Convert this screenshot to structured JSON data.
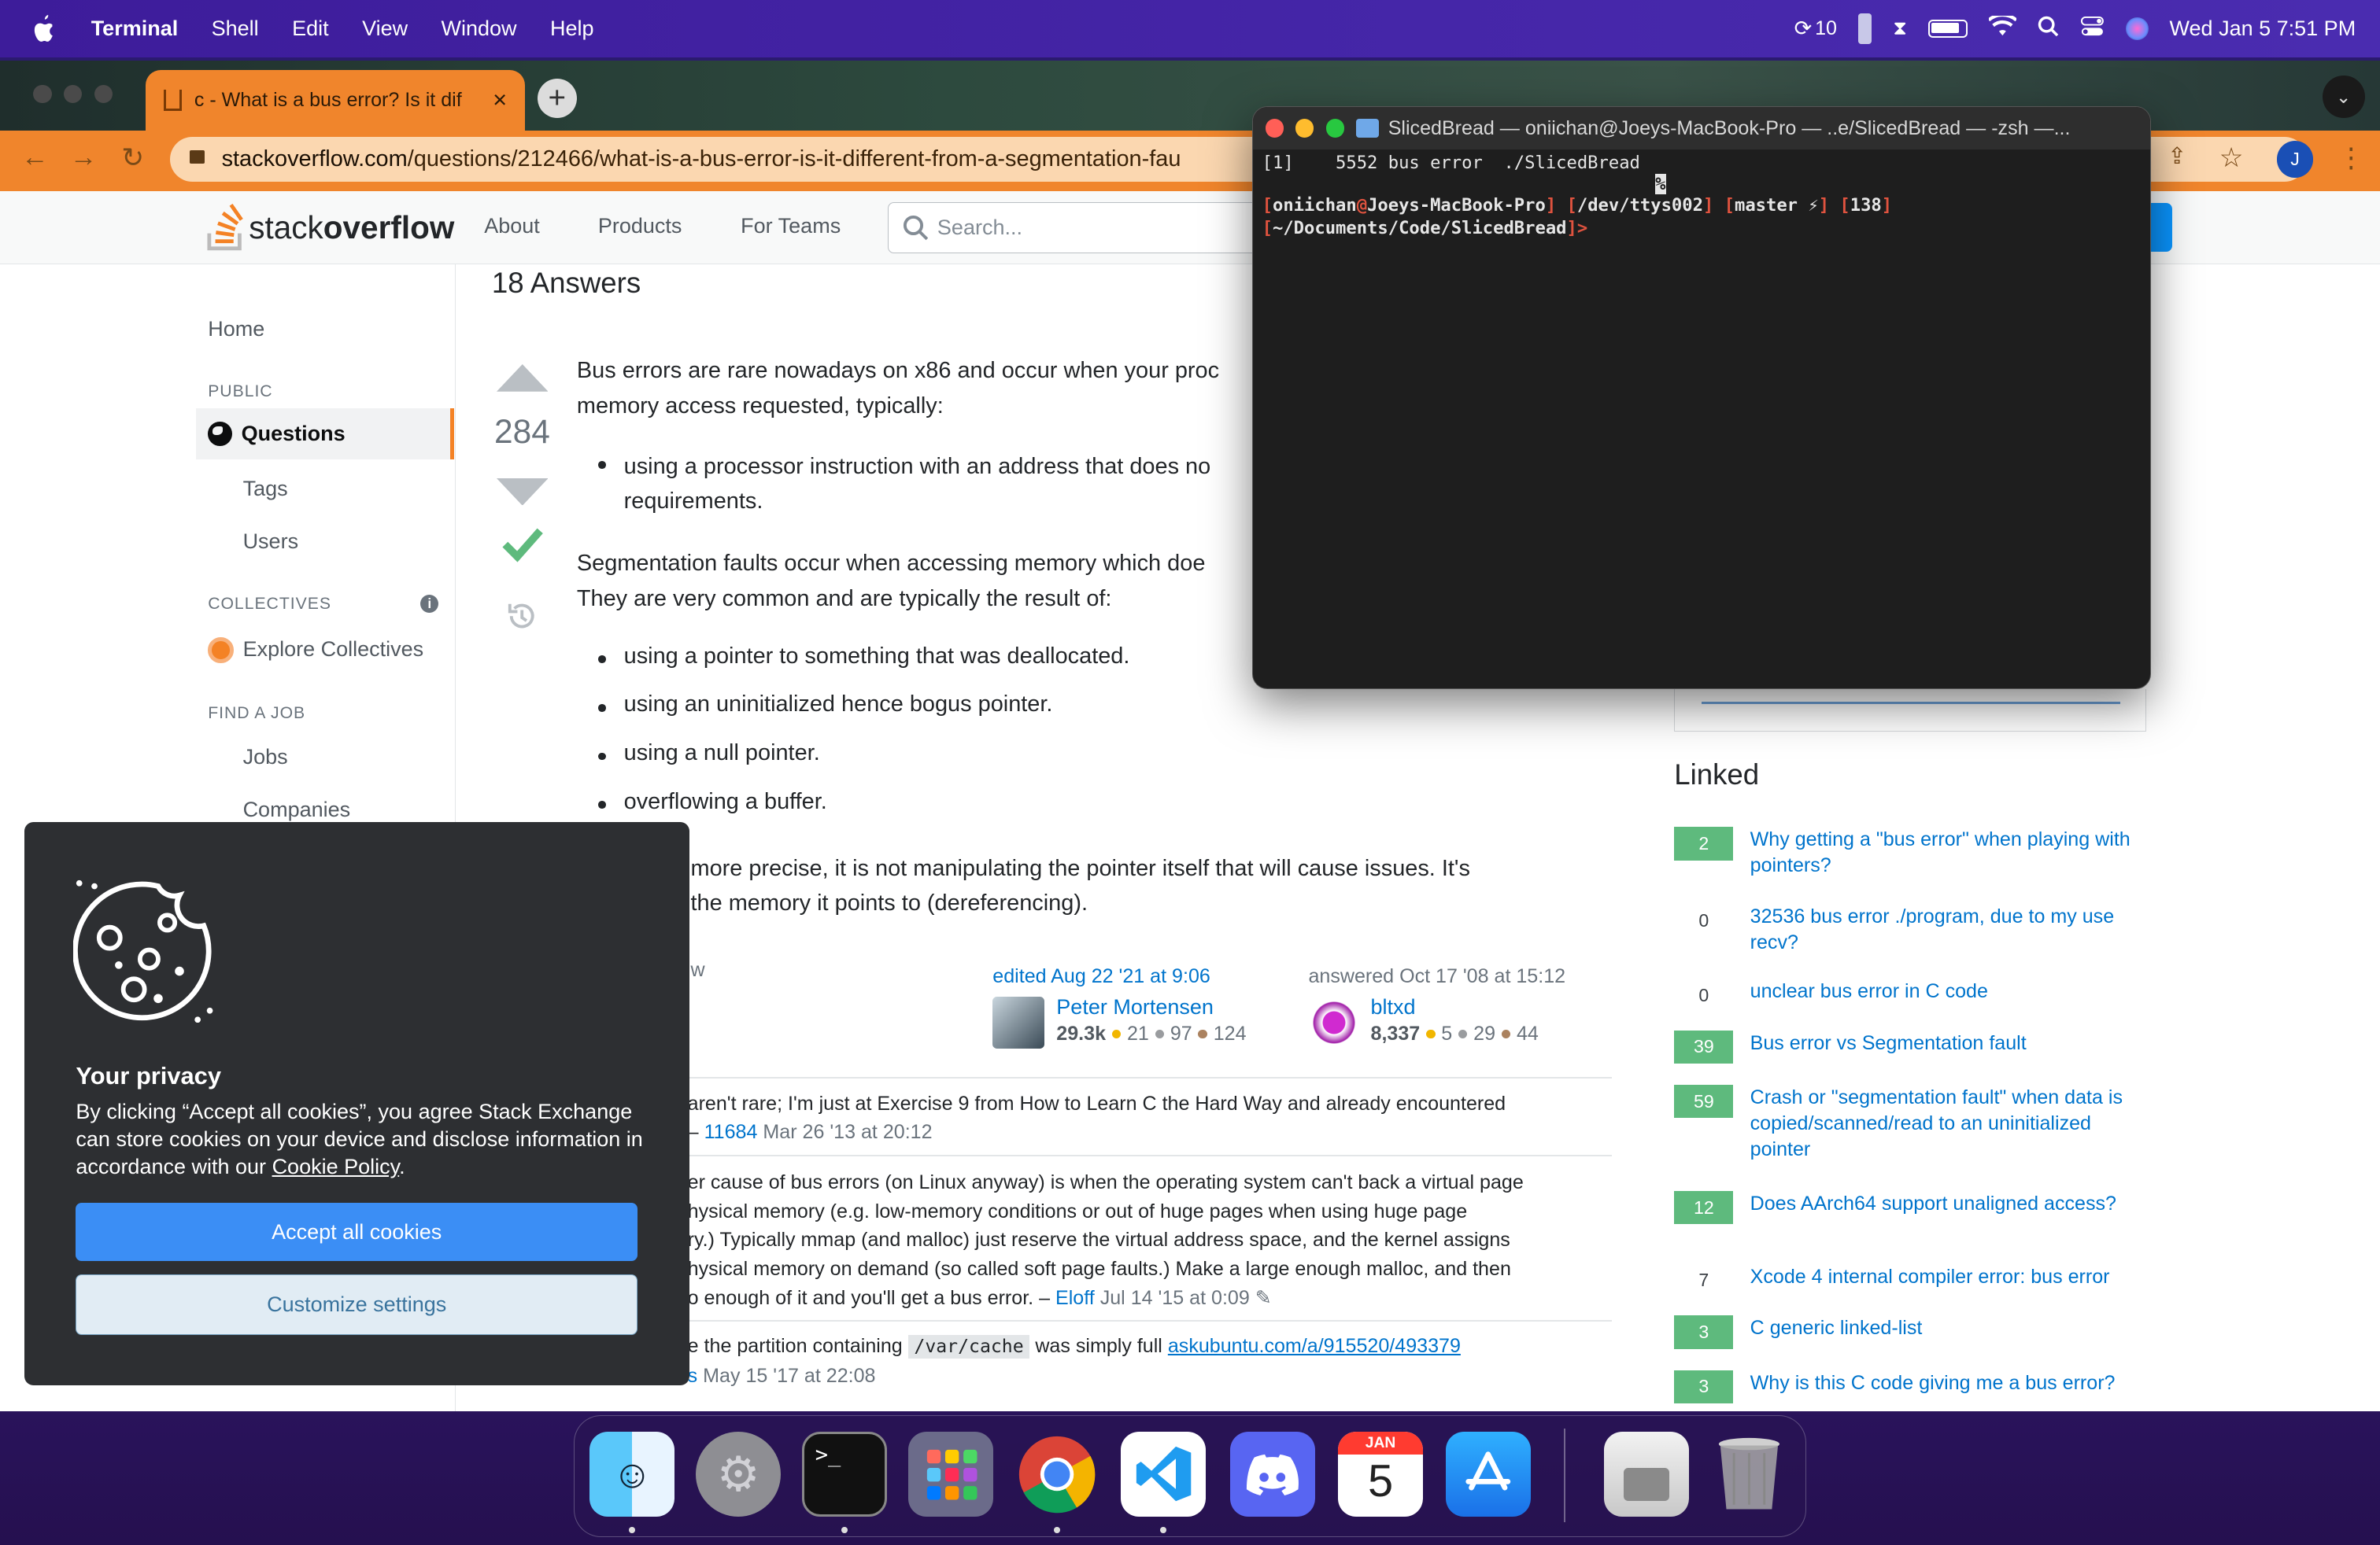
{
  "menubar": {
    "app": "Terminal",
    "items": [
      "Shell",
      "Edit",
      "View",
      "Window",
      "Help"
    ],
    "status": {
      "updates": "10",
      "datetime": "Wed Jan 5  7:51 PM"
    }
  },
  "browser": {
    "tab_title": "c - What is a bus error? Is it dif",
    "url_host": "stackoverflow.com",
    "url_path": "/questions/212466/what-is-a-bus-error-is-it-different-from-a-segmentation-fau",
    "profile_initial": "J"
  },
  "so_header": {
    "logo_a": "stack",
    "logo_b": "overflow",
    "nav": [
      "About",
      "Products",
      "For Teams"
    ],
    "search_placeholder": "Search..."
  },
  "sidebar": {
    "home": "Home",
    "public_heading": "PUBLIC",
    "questions": "Questions",
    "tags": "Tags",
    "users": "Users",
    "collectives_heading": "COLLECTIVES",
    "explore_collectives": "Explore Collectives",
    "find_job_heading": "FIND A JOB",
    "jobs": "Jobs",
    "companies": "Companies"
  },
  "answer": {
    "answers_count": "18 Answers",
    "score": "284",
    "p1a": "Bus errors are rare nowadays on x86 and occur when your proc",
    "p1b": "memory access requested, typically:",
    "b1a": "using a processor instruction with an address that does no",
    "b1b": "requirements.",
    "p2a": "Segmentation faults occur when accessing memory which doe",
    "p2b": "They are very common and are typically the result of:",
    "bullets": [
      "using a pointer to something that was deallocated.",
      "using an uninitialized hence bogus pointer.",
      "using a null pointer.",
      "overflowing a buffer."
    ],
    "p3a": "more precise, it is not manipulating the pointer itself that will cause issues. It's",
    "p3b": "the memory it points to (dereferencing).",
    "follow_fragment": "w",
    "edited": "edited Aug 22 '21 at 9:06",
    "editor": "Peter Mortensen",
    "editor_rep": "29.3k",
    "editor_badges": [
      "21",
      "97",
      "124"
    ],
    "answered": "answered Oct 17 '08 at 15:12",
    "author": "bltxd",
    "author_rep": "8,337",
    "author_badges": [
      "5",
      "29",
      "44"
    ]
  },
  "comments": [
    {
      "text": "aren't rare; I'm just at Exercise 9 from How to Learn C the Hard Way and already encountered",
      "sep": "–",
      "user": "11684",
      "date": "Mar 26 '13 at 20:12"
    },
    {
      "lines": [
        "er cause of bus errors (on Linux anyway) is when the operating system can't back a virtual page",
        "hysical memory (e.g. low-memory conditions or out of huge pages when using huge page",
        "ry.) Typically mmap (and malloc) just reserve the virtual address space, and the kernel assigns",
        "hysical memory on demand (so called soft page faults.) Make a large enough malloc, and then",
        "o enough of it and you'll get a bus error. –"
      ],
      "user": "Eloff",
      "date": "Jul 14 '15 at 0:09"
    },
    {
      "pre": "e the partition containing",
      "code": "/var/cache",
      "mid": "was simply full",
      "link": "askubuntu.com/a/915520/493379",
      "user": "s",
      "date": "May 15 '17 at 22:08"
    }
  ],
  "linked": {
    "heading": "Linked",
    "items": [
      {
        "count": "2",
        "accepted": true,
        "title": "Why getting a \"bus error\" when playing with pointers?"
      },
      {
        "count": "0",
        "accepted": false,
        "title": "32536 bus error ./program, due to my use recv?"
      },
      {
        "count": "0",
        "accepted": false,
        "title": "unclear bus error in C code"
      },
      {
        "count": "39",
        "accepted": true,
        "title": "Bus error vs Segmentation fault"
      },
      {
        "count": "59",
        "accepted": true,
        "title": "Crash or \"segmentation fault\" when data is copied/scanned/read to an uninitialized pointer"
      },
      {
        "count": "12",
        "accepted": true,
        "title": "Does AArch64 support unaligned access?"
      },
      {
        "count": "7",
        "accepted": false,
        "title": "Xcode 4 internal compiler error: bus error"
      },
      {
        "count": "3",
        "accepted": true,
        "title": "C generic linked-list"
      },
      {
        "count": "3",
        "accepted": true,
        "title": "Why is this C code giving me a bus error?"
      }
    ]
  },
  "terminal": {
    "title": "SlicedBread — oniichan@Joeys-MacBook-Pro — ..e/SlicedBread — -zsh —...",
    "line1": "[1]    5552 bus error  ./SlicedBread",
    "percent": "%",
    "prompt_user": "oniichan",
    "prompt_at": "@",
    "prompt_host": "Joeys-MacBook-Pro",
    "prompt_tty": "/dev/ttys002",
    "prompt_branch": "master ⚡",
    "prompt_code": "138",
    "prompt_dir": "~/Documents/Code/SlicedBread",
    "prompt_end": ">"
  },
  "cookie": {
    "title": "Your privacy",
    "body": "By clicking “Accept all cookies”, you agree Stack Exchange can store cookies on your device and disclose information in accordance with our",
    "policy_link": "Cookie Policy",
    "accept": "Accept all cookies",
    "customize": "Customize settings"
  },
  "dock": {
    "calendar_month": "JAN",
    "calendar_day": "5"
  },
  "colors": {
    "so_orange": "#f48225",
    "accepted_green": "#5eba7d",
    "link_blue": "#0074cc",
    "chrome_orange": "#f0852c"
  }
}
